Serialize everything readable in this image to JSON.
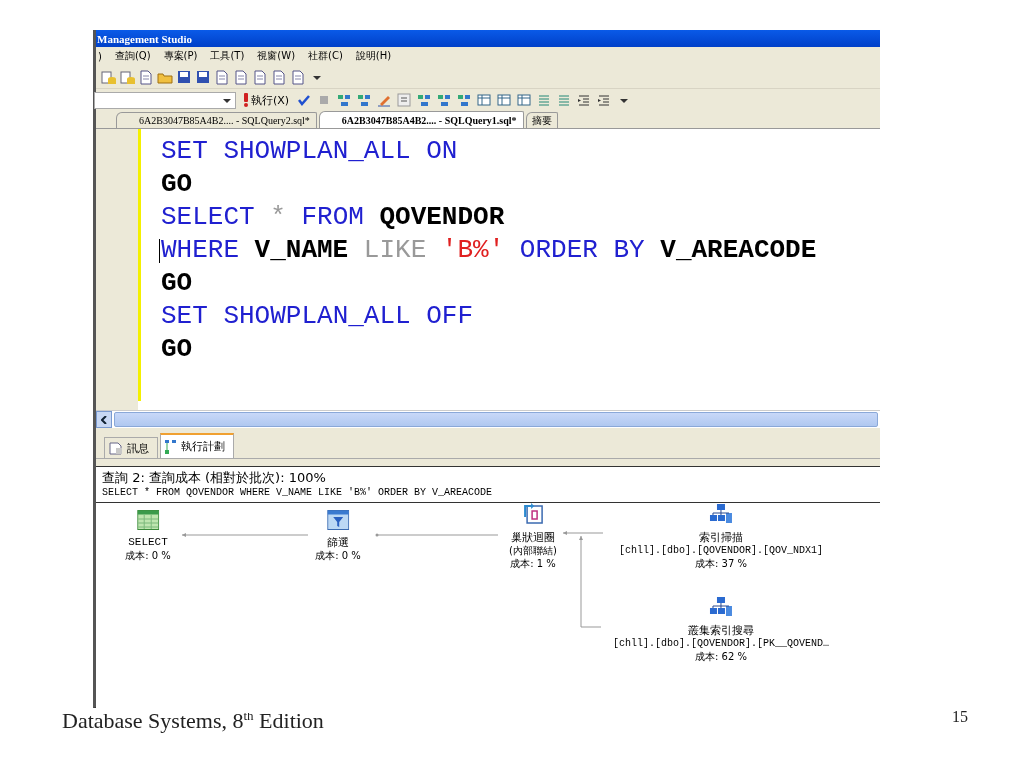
{
  "window": {
    "title": "Management Studio"
  },
  "menu": [
    ")",
    "查詢(Q)",
    "專案(P)",
    "工具(T)",
    "視窗(W)",
    "社群(C)",
    "說明(H)"
  ],
  "toolbar": {
    "execute": "執行(X)"
  },
  "document_tabs": [
    {
      "label": "6A2B3047B85A4B2.... - SQLQuery2.sql*",
      "selected": false
    },
    {
      "label": "6A2B3047B85A4B2.... - SQLQuery1.sql*",
      "selected": true
    },
    {
      "label": "摘要",
      "selected": false
    }
  ],
  "editor": {
    "lines": [
      [
        {
          "kind": "keyword",
          "text": "SET SHOWPLAN_ALL ON"
        }
      ],
      [
        {
          "kind": "identifier",
          "text": "GO"
        }
      ],
      [
        {
          "kind": "keyword",
          "text": "SELECT"
        },
        {
          "kind": "operator",
          "text": "*"
        },
        {
          "kind": "keyword",
          "text": "FROM"
        },
        {
          "kind": "identifier",
          "text": "QOVENDOR"
        }
      ],
      [
        {
          "kind": "keyword",
          "text": "WHERE"
        },
        {
          "kind": "identifier",
          "text": "V_NAME"
        },
        {
          "kind": "operator",
          "text": "LIKE"
        },
        {
          "kind": "string",
          "text": "'B%'"
        },
        {
          "kind": "keyword",
          "text": "ORDER BY"
        },
        {
          "kind": "identifier",
          "text": "V_AREACODE"
        }
      ],
      [
        {
          "kind": "identifier",
          "text": "GO"
        }
      ],
      [
        {
          "kind": "keyword",
          "text": "SET SHOWPLAN_ALL OFF"
        }
      ],
      [
        {
          "kind": "identifier",
          "text": "GO"
        }
      ]
    ]
  },
  "result_tabs": [
    {
      "label": "訊息",
      "selected": false
    },
    {
      "label": "執行計劃",
      "selected": true
    }
  ],
  "plan": {
    "header": "查詢 2: 查詢成本 (相對於批次): 100%",
    "statement": "SELECT * FROM QOVENDOR WHERE V_NAME LIKE 'B%' ORDER BY V_AREACODE",
    "nodes": [
      {
        "kind": "select",
        "label": "SELECT",
        "cost": "成本: 0 %"
      },
      {
        "kind": "filter",
        "label": "篩選",
        "cost": "成本: 0 %"
      },
      {
        "kind": "nested_loops",
        "label": "巢狀迴圈",
        "detail": "(內部聯結)",
        "cost": "成本: 1 %"
      },
      {
        "kind": "index_scan",
        "label": "索引掃描",
        "object": "[chll].[dbo].[QOVENDOR].[QOV_NDX1]",
        "cost": "成本: 37 %"
      },
      {
        "kind": "clustered_seek",
        "label": "叢集索引搜尋",
        "object": "[chll].[dbo].[QOVENDOR].[PK__QOVEND…",
        "cost": "成本: 62 %"
      }
    ]
  },
  "footer": {
    "text": "Database Systems, 8$^{th}$ Edition",
    "page": "15"
  }
}
